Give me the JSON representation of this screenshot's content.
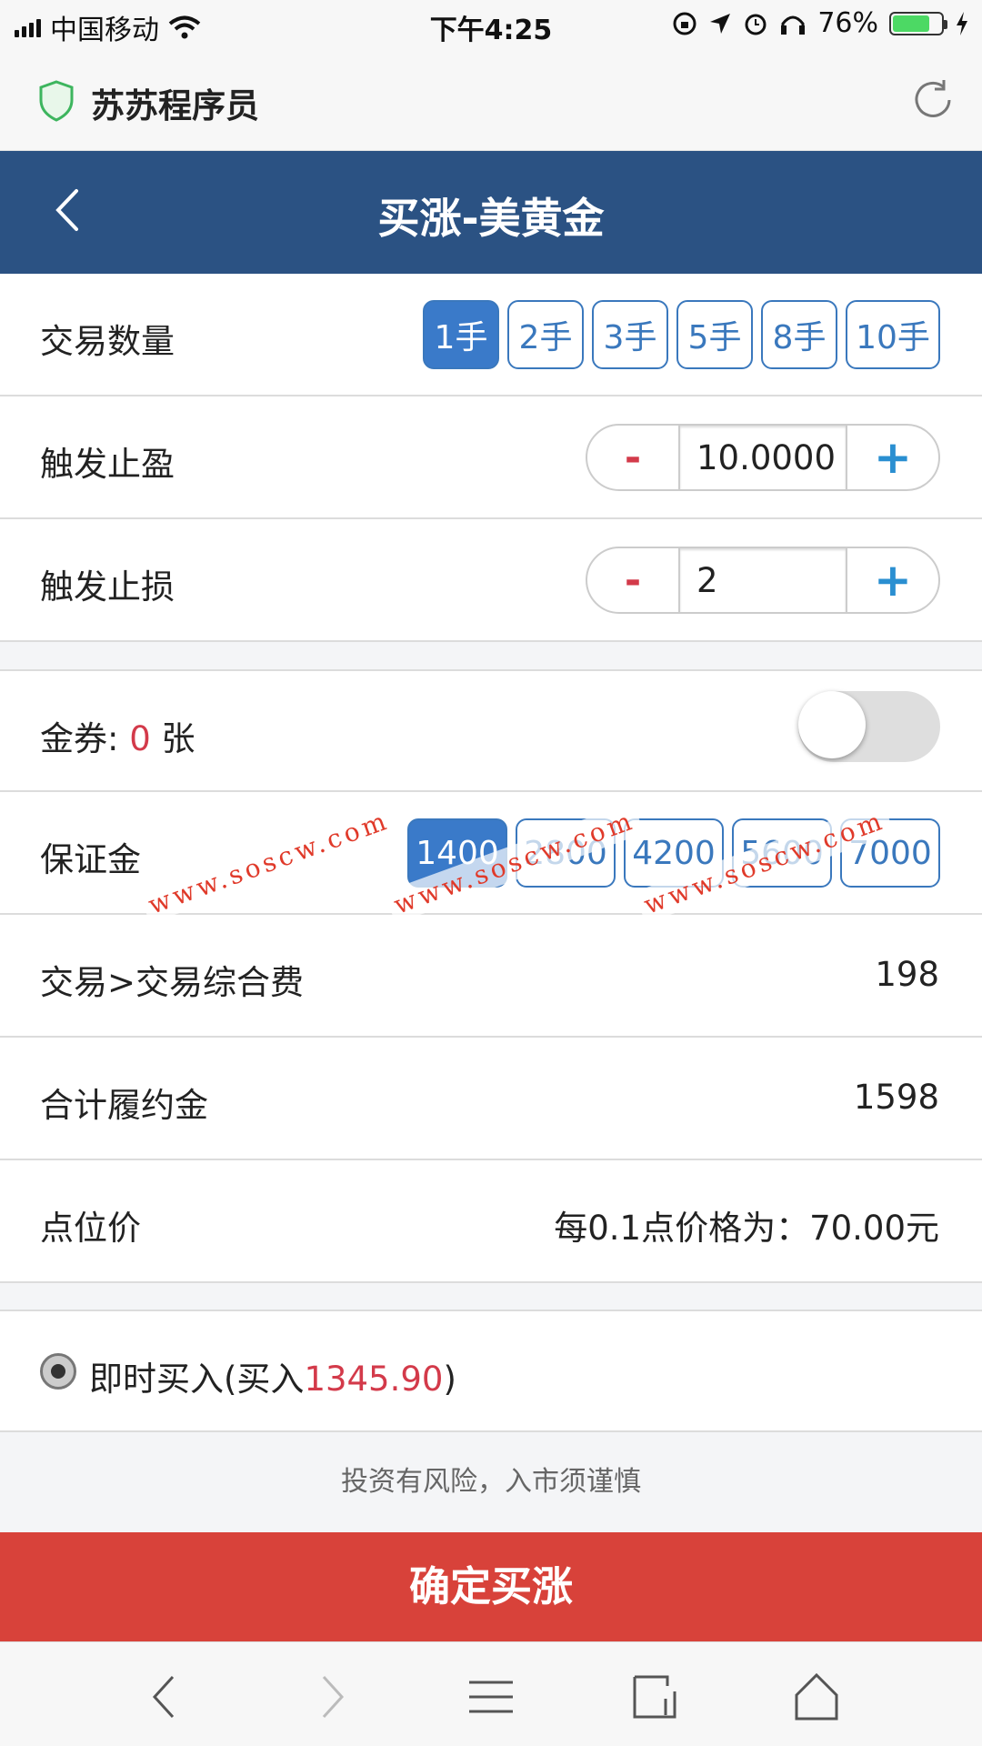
{
  "status_bar": {
    "carrier": "中国移动",
    "time": "下午4:25",
    "battery": "76%",
    "battery_level": 0.76
  },
  "browser": {
    "site_title": "苏苏程序员"
  },
  "header": {
    "title": "买涨-美黄金"
  },
  "quantity": {
    "label": "交易数量",
    "options": [
      "1手",
      "2手",
      "3手",
      "5手",
      "8手",
      "10手"
    ],
    "selected": "1手"
  },
  "take_profit": {
    "label": "触发止盈",
    "minus": "-",
    "value": "10.0000",
    "plus": "+"
  },
  "stop_loss": {
    "label": "触发止损",
    "minus": "-",
    "value": "2",
    "plus": "+"
  },
  "coupon": {
    "prefix": "金券: ",
    "count": "0",
    "suffix": " 张",
    "enabled": false
  },
  "margin": {
    "label": "保证金",
    "options": [
      "1400",
      "2800",
      "4200",
      "5600",
      "7000"
    ],
    "selected": "1400"
  },
  "fee": {
    "label": "交易>交易综合费",
    "value": "198"
  },
  "total": {
    "label": "合计履约金",
    "value": "1598"
  },
  "point_price": {
    "label": "点位价",
    "value": "每0.1点价格为：70.00元"
  },
  "buy_mode": {
    "prefix": "即时买入(买入",
    "price": "1345.90",
    "suffix": ")"
  },
  "notice": "投资有风险，入市须谨慎",
  "confirm_button": "确定买涨",
  "watermarks": [
    "www.soscw.com",
    "www.soscw.com",
    "www.soscw.com"
  ],
  "colors": {
    "header_bg": "#2b5283",
    "accent_blue": "#3a7ac9",
    "confirm_red": "#d8423a",
    "price_red": "#d33a4a"
  }
}
